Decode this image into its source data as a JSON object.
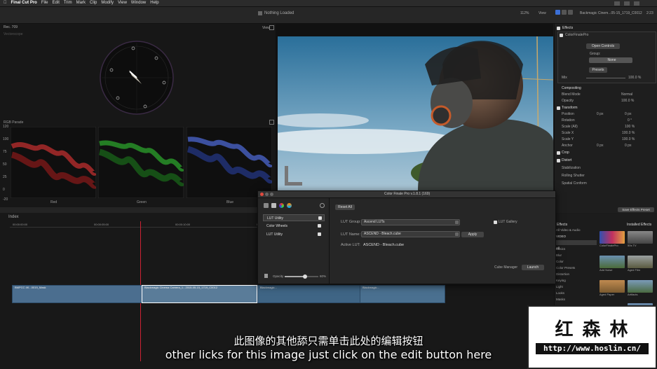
{
  "menu": {
    "apple": "",
    "app": "Final Cut Pro",
    "items": [
      "File",
      "Edit",
      "Trim",
      "Mark",
      "Clip",
      "Modify",
      "View",
      "Window",
      "Help"
    ]
  },
  "toolbar": {
    "status": "Nothing Loaded",
    "zoom": "112%",
    "view": "View",
    "timecode": "2:23"
  },
  "scopes": {
    "rec": "Rec. 709",
    "vectorscope_label": "Vectorscope",
    "parade_label": "RGB Parade",
    "scale": [
      "120",
      "100",
      "75",
      "50",
      "25",
      "0",
      "-20"
    ],
    "channels": [
      "Red",
      "Green",
      "Blue"
    ]
  },
  "viewer": {
    "view_label": "View",
    "clip_name": "Backmagic Cinem...05-15_1719_C0012"
  },
  "timeline": {
    "index_label": "Index",
    "timecodes": [
      "00:00:00:00",
      "00:00:05:00",
      "00:00:10:00",
      "00:00:15:00",
      "00:00:20:00",
      "00:00:25:00"
    ],
    "clips": [
      "BMPCC 4K...0019_Mask",
      "Blackmagic Cinema Camera_1...2015-05-15_1719_C0012",
      "Blackmagic...",
      "Blackmagic..."
    ]
  },
  "inspector": {
    "effects_header": "Effects",
    "effect_name": "ColorFinalePro",
    "open_controls": "Open Controls",
    "group_label": "Group:",
    "group_value": "None",
    "presets": "Presets",
    "mix_label": "Mix",
    "mix_value": "100.0 %",
    "compositing": "Compositing",
    "blend_mode_label": "Blend Mode",
    "blend_mode_value": "Normal",
    "opacity_label": "Opacity",
    "opacity_value": "100.0 %",
    "transform": "Transform",
    "position_label": "Position",
    "position_x": "0 px",
    "position_y": "0 px",
    "rotation_label": "Rotation",
    "rotation_value": "0 °",
    "scale_all_label": "Scale (All)",
    "scale_all_value": "100 %",
    "scale_x_label": "Scale X",
    "scale_x_value": "100.0 %",
    "scale_y_label": "Scale Y",
    "scale_y_value": "100.0 %",
    "anchor_label": "Anchor",
    "anchor_x": "0 px",
    "anchor_y": "0 px",
    "crop": "Crop",
    "distort": "Distort",
    "stabilization": "Stabilization",
    "rolling_shutter": "Rolling Shutter",
    "spatial_conform": "Spatial Conform",
    "save_preset": "Save Effects Preset"
  },
  "browser": {
    "header": "Effects",
    "installed": "Installed Effects",
    "categories": [
      "All Video & Audio",
      "VIDEO",
      "All",
      "Basics",
      "Blur",
      "Color",
      "Color Presets",
      "Distortion",
      "Keying",
      "Light",
      "Looks",
      "Masks",
      "",
      "Stylize",
      "Text Effects",
      "Tiling",
      "",
      "Distortion",
      "",
      "Levels"
    ],
    "thumbs": [
      "ColorFinalePro",
      "50s TV",
      "Add Noise",
      "Aged Film",
      "Aged Paper",
      "Artifacts",
      "",
      "Background Squares"
    ]
  },
  "colorfinale": {
    "title": "Color Finale Pro v.1.8.1 (169)",
    "layers": [
      "LUT Utility",
      "Color Wheels",
      "LUT Utility"
    ],
    "reset_all": "Reset All",
    "lut_group_label": "LUT Group:",
    "lut_group_value": "Ascend LUTs",
    "lut_name_label": "LUT Name:",
    "lut_name_value": "ASCEND - Bleach.cube",
    "apply": "Apply",
    "active_lut_label": "Active LUT:",
    "active_lut_value": "ASCEND - Bleach.cube",
    "lut_gallery": "LUT Gallery",
    "cube_manager": "Cube Manager",
    "launch": "Launch",
    "opacity_label": "Opacity",
    "opacity_value": "60%",
    "opacity_level": 0.6
  },
  "watermark": {
    "cn": "红 森 林",
    "url": "http://www.hoslin.cn/"
  },
  "subtitle": {
    "cn": "此图像的其他舔只需单击此处的编辑按钮",
    "en": "other licks for this image just click on the edit button here"
  }
}
